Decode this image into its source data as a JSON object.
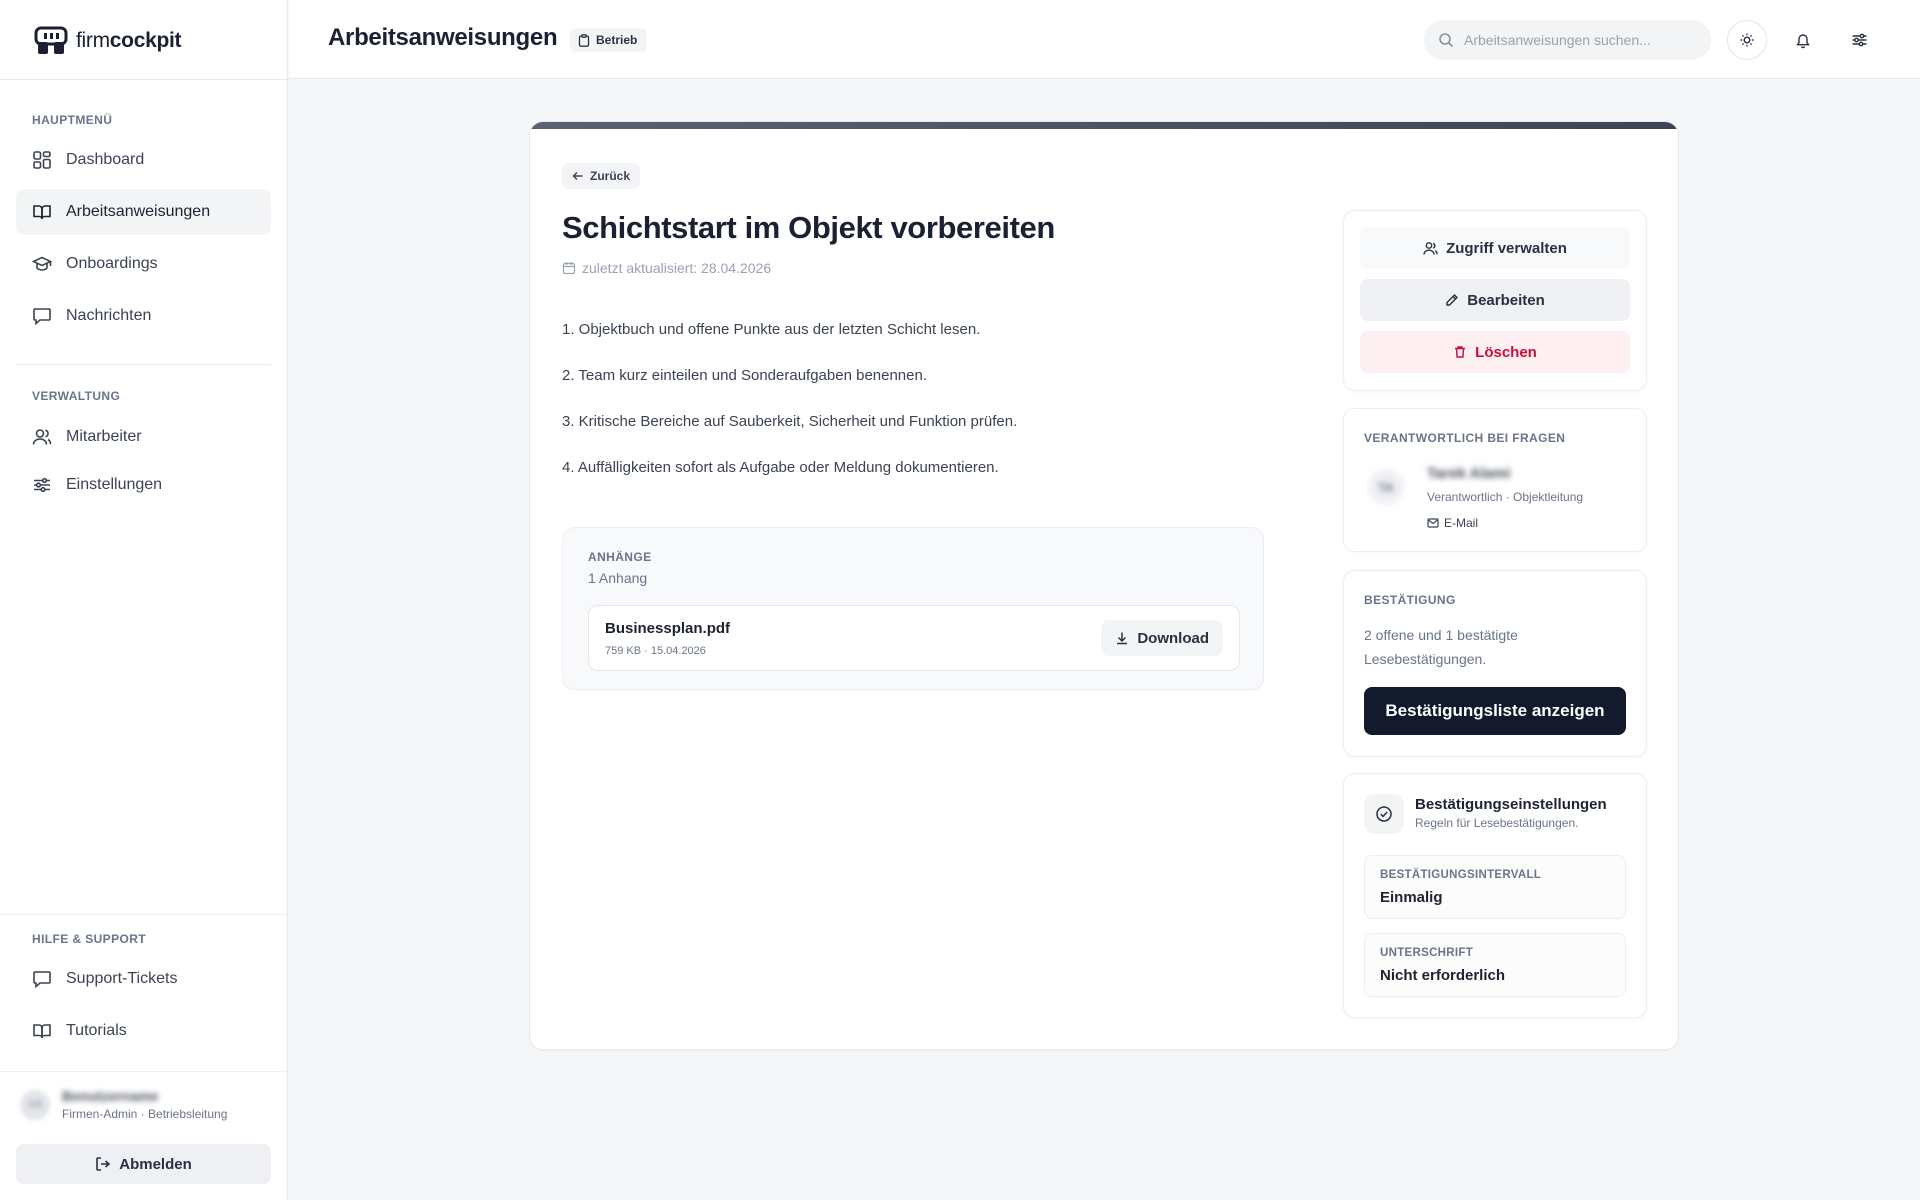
{
  "brand": {
    "name_light": "firm",
    "name_bold": "cockpit"
  },
  "sidebar": {
    "sections": [
      {
        "label": "HAUPTMENÜ"
      },
      {
        "label": "VERWALTUNG"
      },
      {
        "label": "HILFE & SUPPORT"
      }
    ],
    "main_items": [
      {
        "label": "Dashboard",
        "icon": "grid-icon"
      },
      {
        "label": "Arbeitsanweisungen",
        "icon": "book-icon",
        "active": true
      },
      {
        "label": "Onboardings",
        "icon": "graduation-cap-icon"
      },
      {
        "label": "Nachrichten",
        "icon": "message-icon"
      }
    ],
    "admin_items": [
      {
        "label": "Mitarbeiter",
        "icon": "users-icon"
      },
      {
        "label": "Einstellungen",
        "icon": "sliders-icon"
      }
    ],
    "support_items": [
      {
        "label": "Support-Tickets",
        "icon": "message-icon"
      },
      {
        "label": "Tutorials",
        "icon": "book-icon"
      }
    ],
    "user": {
      "initials": "SB",
      "name": "Benutzername",
      "role": "Firmen-Admin · Betriebsleitung"
    },
    "logout_label": "Abmelden"
  },
  "header": {
    "title": "Arbeitsanweisungen",
    "badge": "Betrieb",
    "search_placeholder": "Arbeitsanweisungen suchen..."
  },
  "document": {
    "back_label": "Zurück",
    "title": "Schichtstart im Objekt vorbereiten",
    "updated": "zuletzt aktualisiert: 28.04.2026",
    "steps": [
      "1. Objektbuch und offene Punkte aus der letzten Schicht lesen.",
      "2. Team kurz einteilen und Sonderaufgaben benennen.",
      "3. Kritische Bereiche auf Sauberkeit, Sicherheit und Funktion prüfen.",
      "4. Auffälligkeiten sofort als Aufgabe oder Meldung dokumentieren."
    ],
    "attachments": {
      "label": "ANHÄNGE",
      "count": "1 Anhang",
      "files": [
        {
          "name": "Businessplan.pdf",
          "meta": "759 KB · 15.04.2026",
          "download_label": "Download"
        }
      ]
    }
  },
  "actions": {
    "manage_label": "Zugriff verwalten",
    "edit_label": "Bearbeiten",
    "delete_label": "Löschen"
  },
  "contact": {
    "label": "VERANTWORTLICH BEI FRAGEN",
    "initials": "TA",
    "name": "Tarek Alami",
    "role": "Verantwortlich · Objektleitung",
    "email_label": "E-Mail"
  },
  "confirmation": {
    "label": "BESTÄTIGUNG",
    "text": "2 offene und 1 bestätigte Lesebestätigungen.",
    "button_label": "Bestätigungsliste anzeigen"
  },
  "confirmation_settings": {
    "title": "Bestätigungseinstellungen",
    "subtitle": "Regeln für Lesebestätigungen.",
    "interval_label": "BESTÄTIGUNGSINTERVALL",
    "interval_value": "Einmalig",
    "signature_label": "UNTERSCHRIFT",
    "signature_value": "Nicht erforderlich"
  },
  "colors": {
    "primary_dark": "#121a2c",
    "danger": "#c8103c",
    "danger_bg": "#feeff1",
    "muted_text": "#6b7488",
    "accent_bar": "#4a5264"
  }
}
